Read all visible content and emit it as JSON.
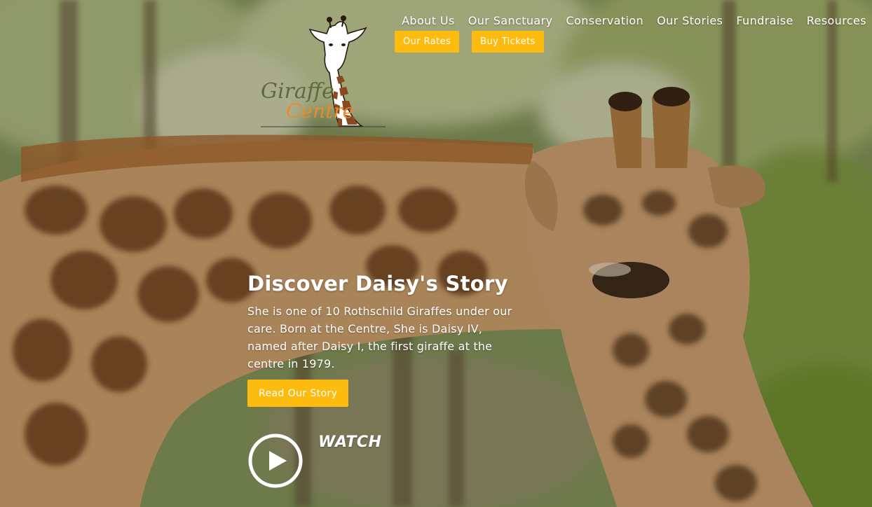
{
  "logo": {
    "line1": "Giraffe",
    "line2": "Centre"
  },
  "nav": {
    "items": [
      "About Us",
      "Our Sanctuary",
      "Conservation",
      "Our Stories",
      "Fundraise",
      "Resources"
    ],
    "rates_label": "Our Rates",
    "tickets_label": "Buy Tickets"
  },
  "hero": {
    "title": "Discover Daisy's Story",
    "body": "She is one of 10 Rothschild Giraffes under our care. Born at the Centre, She is Daisy IV, named after Daisy I, the first giraffe at the centre in 1979.",
    "cta_label": "Read Our Story",
    "watch_label": "WATCH"
  },
  "colors": {
    "accent": "#fdbb10",
    "logo_green": "#5a6b3e",
    "logo_orange": "#e88a2e"
  },
  "icons": [
    "giraffe-logo-icon",
    "play-circle-icon"
  ]
}
